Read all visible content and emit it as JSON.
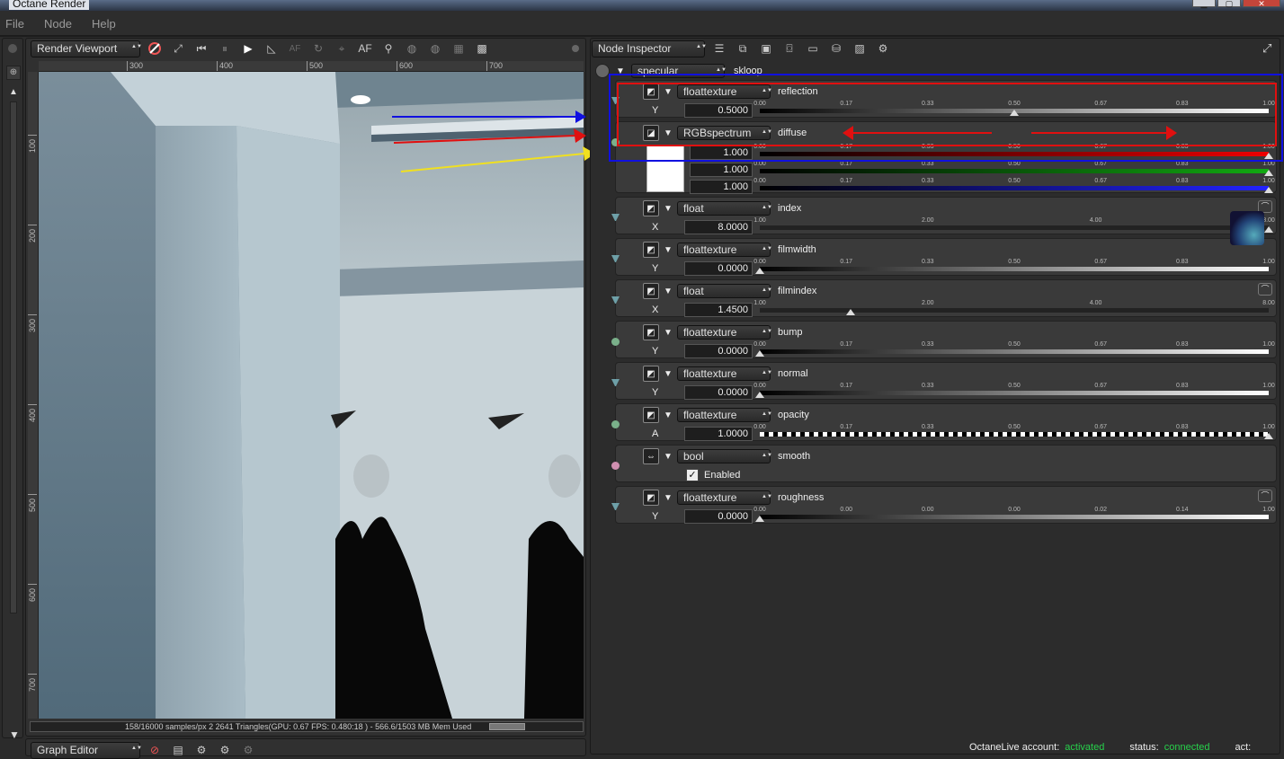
{
  "window": {
    "title": "Octane Render"
  },
  "menu": [
    "File",
    "Node",
    "Help"
  ],
  "viewport": {
    "dropdown": "Render Viewport",
    "toolbar_icons": [
      "lock-icon",
      "fit-icon",
      "rewind-icon",
      "pause-icon",
      "play-icon",
      "ruler-icon",
      "af-disabled-icon",
      "dof-icon",
      "pick-icon",
      "af-icon",
      "focus-icon",
      "sphere-icon",
      "sphere-alt-icon",
      "region-icon",
      "checker-icon"
    ],
    "af_label": "AF",
    "ruler_h": [
      "300",
      "400",
      "500",
      "600",
      "700"
    ],
    "ruler_v": [
      "100",
      "200",
      "300",
      "400",
      "500",
      "600",
      "700"
    ],
    "status": "158/16000 samples/px 2 2641 Triangles(GPU: 0.67 FPS: 0.480:18 ) - 566.6/1503 MB Mem Used"
  },
  "graph_editor": {
    "dropdown": "Graph Editor"
  },
  "inspector": {
    "dropdown": "Node Inspector",
    "header": {
      "type": "specular",
      "name": "skloop"
    },
    "ticks_std": [
      "0.00",
      "0.17",
      "0.33",
      "0.50",
      "0.67",
      "0.83",
      "1.00"
    ],
    "ticks_index": [
      "1.00",
      "2.00",
      "4.00",
      "8.00"
    ],
    "ticks_rough": [
      "0.00",
      "0.00",
      "0.00",
      "0.00",
      "0.02",
      "0.14",
      "1.00"
    ],
    "nodes": [
      {
        "type": "floattexture",
        "name": "reflection",
        "label": "Y",
        "value": "0.5000"
      },
      {
        "type": "RGBspectrum",
        "name": "diffuse",
        "r": "1.000",
        "g": "1.000",
        "b": "1.000"
      },
      {
        "type": "float",
        "name": "index",
        "label": "X",
        "value": "8.0000"
      },
      {
        "type": "floattexture",
        "name": "filmwidth",
        "label": "Y",
        "value": "0.0000"
      },
      {
        "type": "float",
        "name": "filmindex",
        "label": "X",
        "value": "1.4500"
      },
      {
        "type": "floattexture",
        "name": "bump",
        "label": "Y",
        "value": "0.0000"
      },
      {
        "type": "floattexture",
        "name": "normal",
        "label": "Y",
        "value": "0.0000"
      },
      {
        "type": "floattexture",
        "name": "opacity",
        "label": "A",
        "value": "1.0000"
      },
      {
        "type": "bool",
        "name": "smooth",
        "check": "✓",
        "check_label": "Enabled"
      },
      {
        "type": "floattexture",
        "name": "roughness",
        "label": "Y",
        "value": "0.0000"
      }
    ]
  },
  "footer": {
    "account_label": "OctaneLive account:",
    "account_value": "activated",
    "status_label": "status:",
    "status_value": "connected",
    "act_label": "act:"
  },
  "colors": {
    "accent_green": "#27d14b",
    "annot_red": "#e01010",
    "annot_blue": "#1010e0",
    "annot_yellow": "#f0e020"
  }
}
